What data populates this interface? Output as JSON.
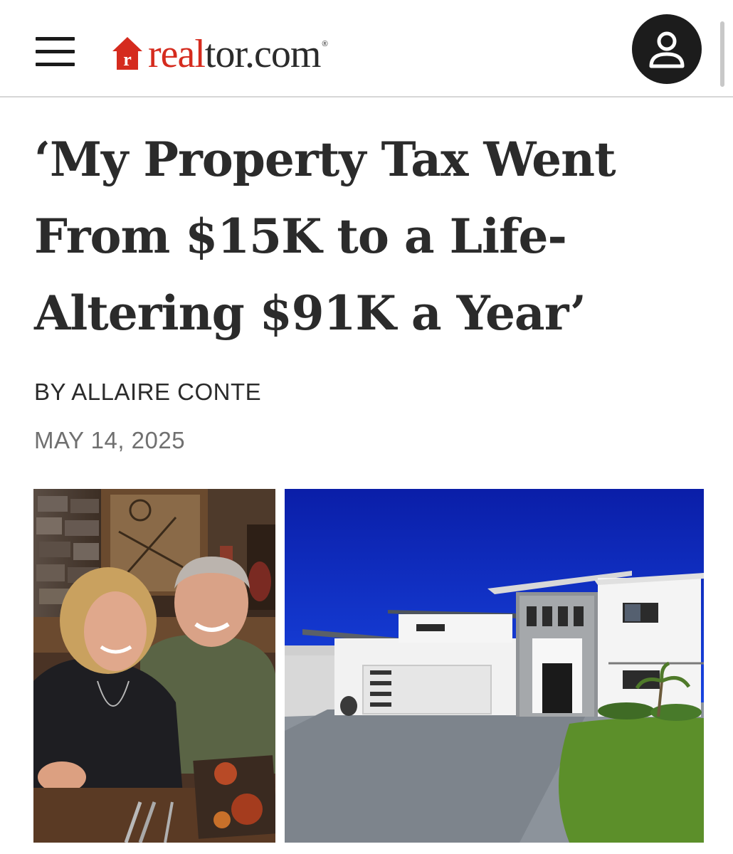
{
  "header": {
    "menu_icon": "hamburger-menu-icon",
    "logo": {
      "part_red": "real",
      "part_dark": "tor.com",
      "registered": "®",
      "house_letter": "r"
    },
    "account_icon": "user-icon"
  },
  "article": {
    "title": "‘My Property Tax Went From $15K to a Life-Altering $91K a Year’",
    "byline": "BY ALLAIRE CONTE",
    "date": "MAY 14, 2025"
  },
  "colors": {
    "brand_red": "#d52b1e",
    "text_dark": "#2b2b2b",
    "date_gray": "#707070",
    "sky_blue": "#0c2fd6"
  },
  "images": [
    {
      "icon": "couple-photo"
    },
    {
      "icon": "house-photo"
    }
  ]
}
